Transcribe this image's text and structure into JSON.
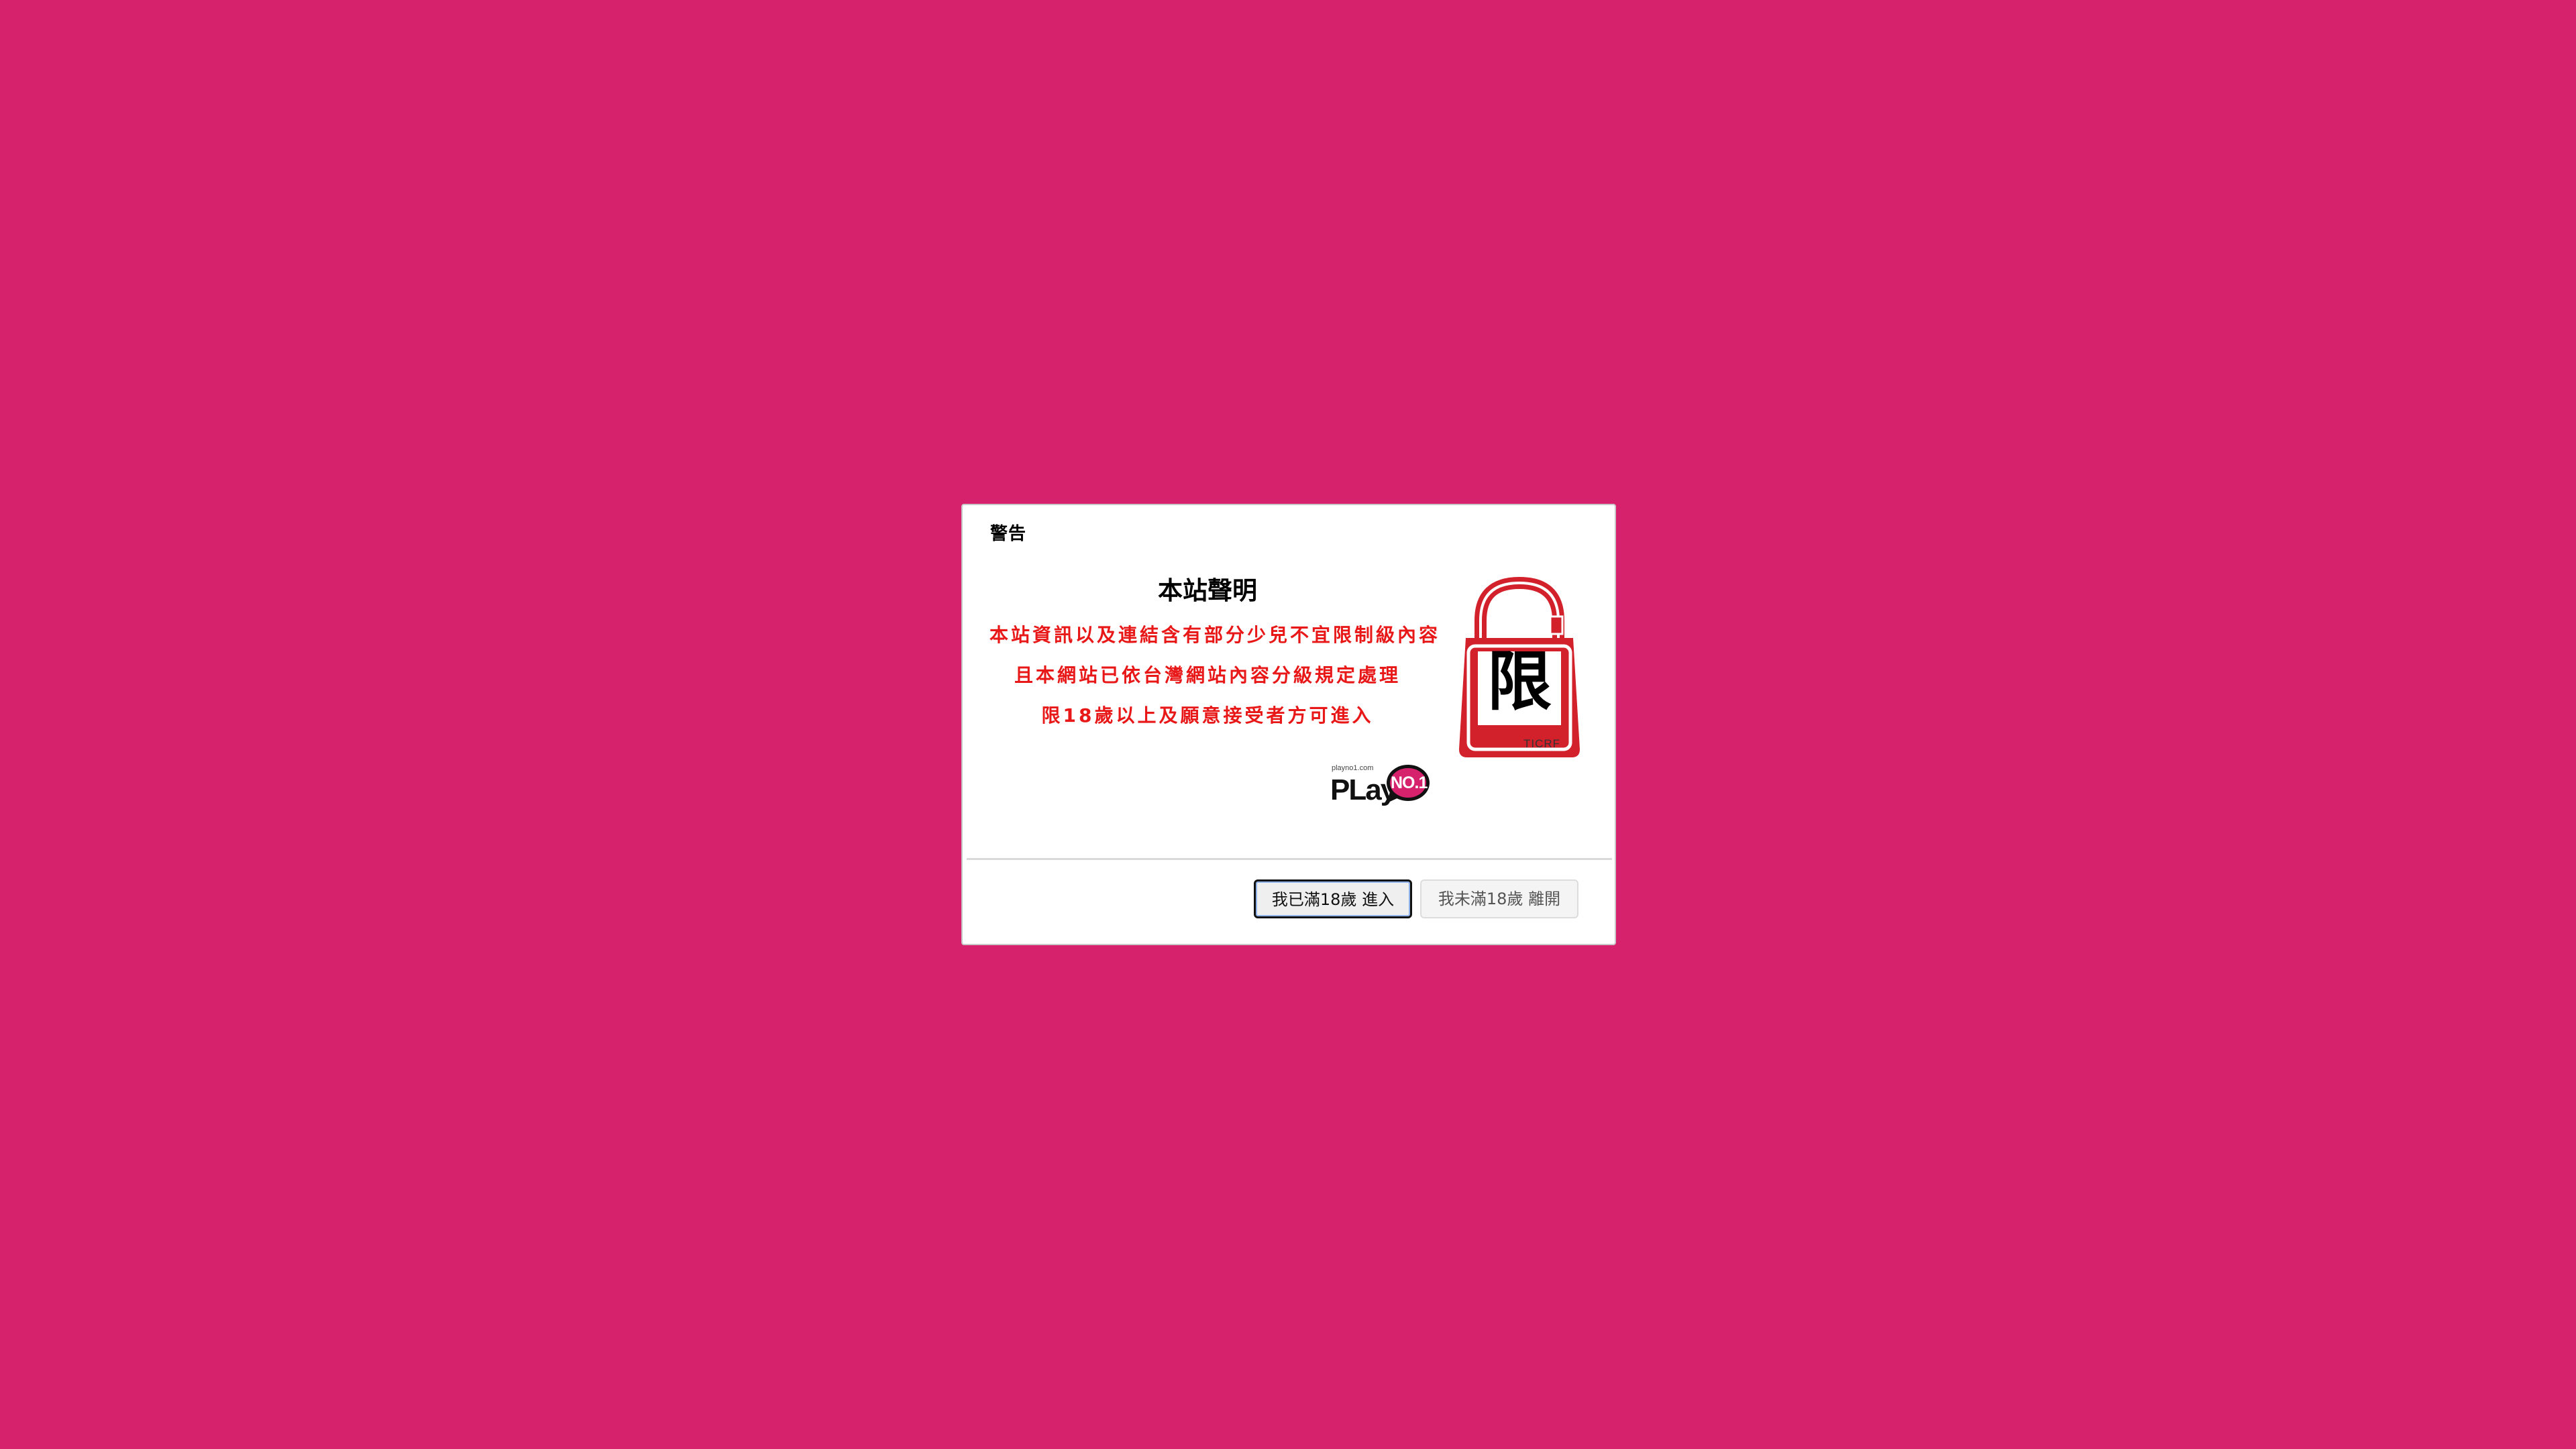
{
  "dialog": {
    "title": "警告",
    "heading": "本站聲明",
    "lines": [
      "本站資訊以及連結含有部分少兒不宜限制級內容",
      "且本網站已依台灣網站內容分級規定處理",
      "限18歲以上及願意接受者方可進入"
    ],
    "rating_badge": {
      "character": "限",
      "label": "TICRF"
    },
    "logo": {
      "small_text": "playno1.com",
      "play_text": "PLay",
      "bubble_text": "NO.1"
    },
    "buttons": {
      "enter_label": "我已滿18歲 進入",
      "leave_label": "我未滿18歲 離開"
    }
  },
  "colors": {
    "background": "#d6216c",
    "warning_text": "#e81818",
    "badge_red": "#d3212b",
    "logo_bubble": "#d6216c"
  },
  "icons": {
    "rating_badge": "padlock-restricted-icon",
    "logo": "playno1-logo"
  }
}
